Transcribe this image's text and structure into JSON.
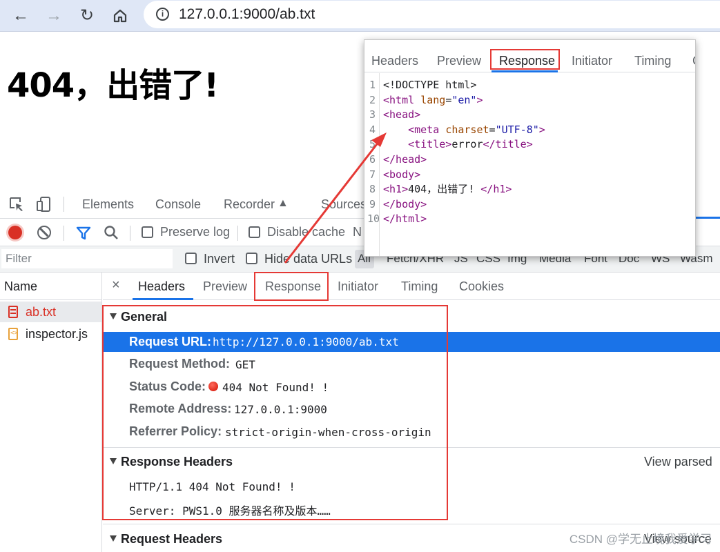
{
  "browser": {
    "url": "127.0.0.1:9000/ab.txt",
    "back_icon": "arrow-left-icon",
    "forward_icon": "arrow-right-icon",
    "reload_icon": "reload-icon",
    "home_icon": "home-icon"
  },
  "page": {
    "heading": "404，出错了!"
  },
  "devtools": {
    "tabs": [
      "Elements",
      "Console",
      "Recorder",
      "Sources"
    ],
    "network_bar": {
      "preserve_log": "Preserve log",
      "disable_cache": "Disable cache",
      "cut_label": "N"
    },
    "filter": {
      "placeholder": "Filter",
      "invert": "Invert",
      "hide_data_urls": "Hide data URLs",
      "types": [
        "All",
        "Fetch/XHR",
        "JS",
        "CSS",
        "Img",
        "Media",
        "Font",
        "Doc",
        "WS",
        "Wasm"
      ]
    },
    "request_list": {
      "header": "Name",
      "items": [
        {
          "name": "ab.txt",
          "selected": true
        },
        {
          "name": "inspector.js",
          "selected": false
        }
      ]
    },
    "detail": {
      "close": "×",
      "tabs": [
        "Headers",
        "Preview",
        "Response",
        "Initiator",
        "Timing",
        "Cookies"
      ],
      "active_tab": "Headers",
      "general": {
        "title": "General",
        "rows": [
          {
            "key": "Request URL:",
            "value": "http://127.0.0.1:9000/ab.txt"
          },
          {
            "key": "Request Method:",
            "value": "GET"
          },
          {
            "key": "Status Code:",
            "value": "404 Not Found! !"
          },
          {
            "key": "Remote Address:",
            "value": "127.0.0.1:9000"
          },
          {
            "key": "Referrer Policy:",
            "value": "strict-origin-when-cross-origin"
          }
        ]
      },
      "response_headers": {
        "title": "Response Headers",
        "view_parsed": "View parsed",
        "lines": [
          "HTTP/1.1 404 Not Found! !",
          "Server: PWS1.0 服务器名称及版本……"
        ]
      },
      "request_headers": {
        "title": "Request Headers",
        "view_source": "View source"
      }
    }
  },
  "popup": {
    "tabs": [
      "Headers",
      "Preview",
      "Response",
      "Initiator",
      "Timing",
      "C"
    ],
    "active_tab": "Response",
    "line_numbers": [
      "1",
      "2",
      "3",
      "4",
      "5",
      "6",
      "7",
      "8",
      "9",
      "10"
    ]
  },
  "watermark": "CSDN @学无止境我爱学习",
  "colors": {
    "accent_blue": "#1a73e8",
    "annotation_red": "#e53935",
    "record_red": "#d93025",
    "file_red": "#d93025",
    "file_orange": "#e8a23b"
  }
}
